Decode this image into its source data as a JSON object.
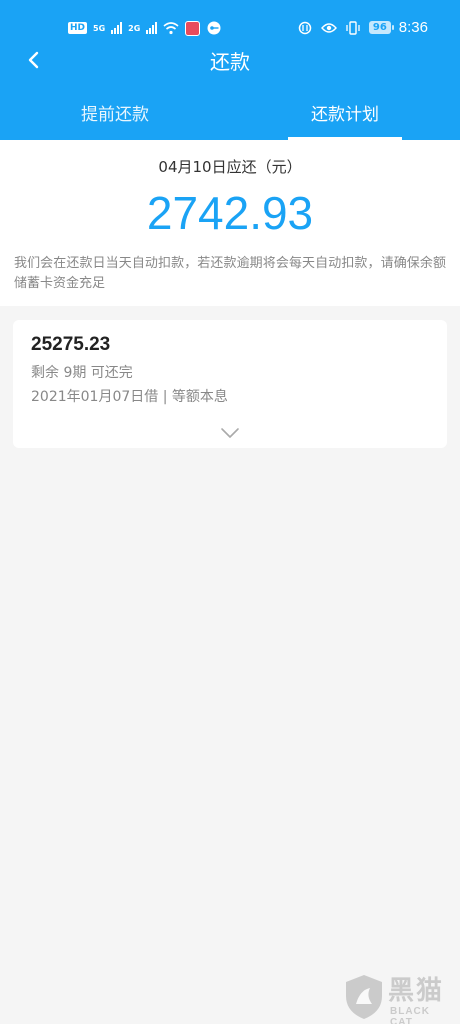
{
  "status_bar": {
    "hd": "HD",
    "network_1": "5G",
    "network_2": "2G",
    "battery": "96",
    "time": "8:36"
  },
  "header": {
    "title": "还款",
    "tabs": [
      {
        "label": "提前还款",
        "active": false
      },
      {
        "label": "还款计划",
        "active": true
      }
    ]
  },
  "summary": {
    "due_label": "04月10日应还（元）",
    "due_amount": "2742.93",
    "notice": "我们会在还款日当天自动扣款，若还款逾期将会每天自动扣款，请确保余额储蓄卡资金充足"
  },
  "loan_card": {
    "amount": "25275.23",
    "remaining": "剩余 9期 可还完",
    "borrow_info": "2021年01月07日借 | 等额本息"
  },
  "watermark": {
    "cn": "黑猫",
    "en": "BLACK CAT"
  },
  "colors": {
    "accent": "#1aa3f5",
    "background": "#f5f5f5"
  }
}
